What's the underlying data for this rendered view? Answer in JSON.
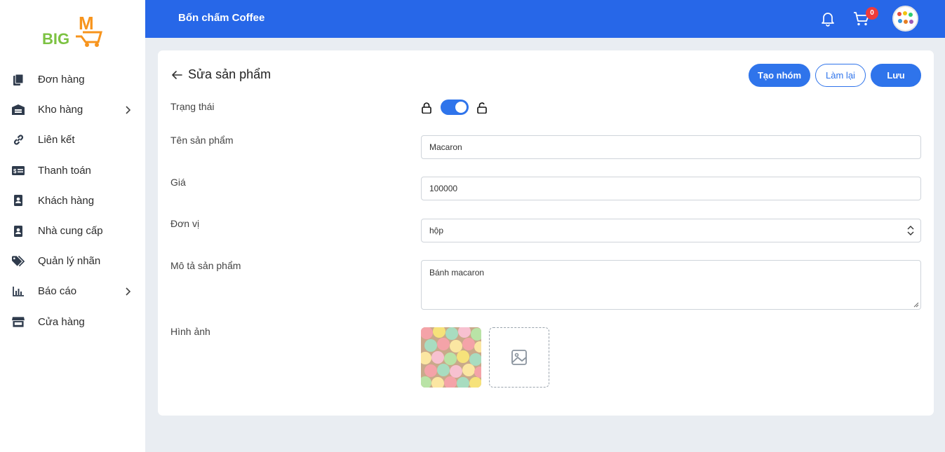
{
  "header": {
    "store_name": "Bốn chấm Coffee",
    "cart_count": "0",
    "accent_color": "#2767e8"
  },
  "logo": {
    "text_big": "BIG",
    "text_m": "M"
  },
  "sidebar": {
    "items": [
      {
        "label": "Đơn hàng",
        "icon": "orders-icon",
        "has_submenu": false
      },
      {
        "label": "Kho hàng",
        "icon": "warehouse-icon",
        "has_submenu": true
      },
      {
        "label": "Liên kết",
        "icon": "link-icon",
        "has_submenu": false
      },
      {
        "label": "Thanh toán",
        "icon": "payment-icon",
        "has_submenu": false
      },
      {
        "label": "Khách hàng",
        "icon": "contact-book-icon",
        "has_submenu": false
      },
      {
        "label": "Nhà cung cấp",
        "icon": "supplier-book-icon",
        "has_submenu": false
      },
      {
        "label": "Quản lý nhãn",
        "icon": "tags-icon",
        "has_submenu": false
      },
      {
        "label": "Báo cáo",
        "icon": "report-chart-icon",
        "has_submenu": true
      },
      {
        "label": "Cửa hàng",
        "icon": "store-icon",
        "has_submenu": false
      }
    ]
  },
  "page": {
    "title": "Sửa sản phẩm",
    "buttons": {
      "create_group": "Tạo nhóm",
      "reset": "Làm lại",
      "save": "Lưu"
    }
  },
  "form": {
    "status_label": "Trạng thái",
    "status_on": true,
    "name_label": "Tên sản phẩm",
    "name_value": "Macaron",
    "price_label": "Giá",
    "price_value": "100000",
    "unit_label": "Đơn vị",
    "unit_value": "hộp",
    "desc_label": "Mô tả sản phẩm",
    "desc_value": "Bánh macaron",
    "image_label": "Hình ảnh"
  }
}
